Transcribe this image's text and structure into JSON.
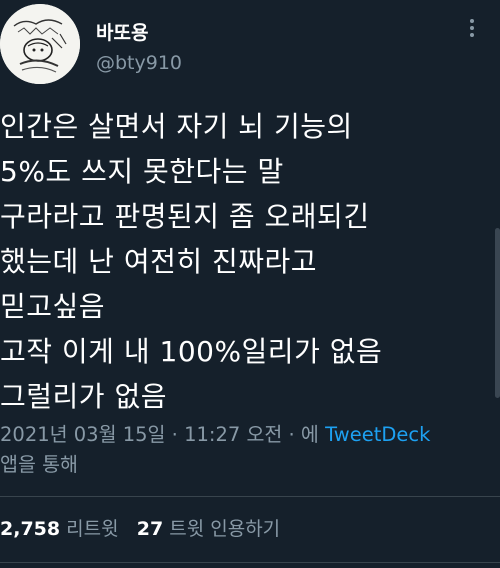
{
  "user": {
    "display_name": "바또용",
    "handle": "@bty910",
    "avatar_icon": "sketch-avatar-icon"
  },
  "more_icon": "more-options-icon",
  "tweet": {
    "text": "인간은 살면서 자기 뇌 기능의\n5%도 쓰지 못한다는 말\n구라라고 판명된지 좀 오래되긴\n했는데 난 여전히 진짜라고\n믿고싶음\n고작 이게 내 100%일리가 없음\n그럴리가 없음"
  },
  "meta": {
    "timestamp": "2021년 03월 15일 · 11:27 오전 · 에",
    "source": "TweetDeck",
    "source_suffix": "앱을 통해"
  },
  "stats": {
    "retweets_count": "2,758",
    "retweets_label": "리트윗",
    "quotes_count": "27",
    "quotes_label": "트윗 인용하기"
  },
  "colors": {
    "background": "#15202b",
    "secondary_text": "#8899a6",
    "link": "#1da1f2",
    "divider": "#38444d"
  }
}
